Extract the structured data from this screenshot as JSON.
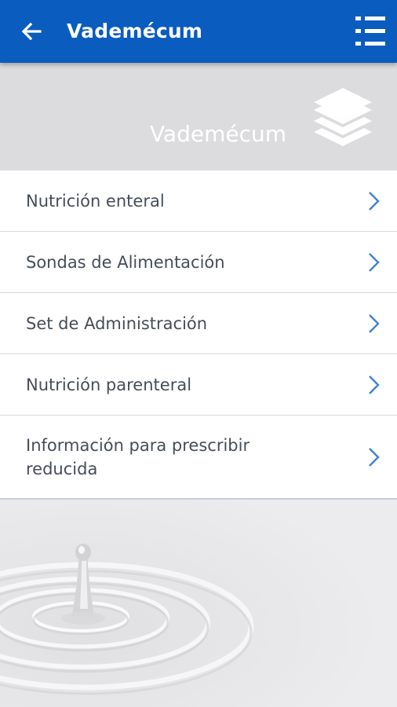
{
  "app_bar": {
    "title": "Vademécum",
    "back_icon": "arrow-left-icon",
    "menu_icon": "list-menu-icon",
    "background_color": "#0a5cbf"
  },
  "banner": {
    "title": "Vademécum",
    "icon": "layers-icon"
  },
  "menu": {
    "items": [
      {
        "label": "Nutrición enteral",
        "icon": "chevron-right-icon"
      },
      {
        "label": "Sondas de Alimentación",
        "icon": "chevron-right-icon"
      },
      {
        "label": "Set de Administración",
        "icon": "chevron-right-icon"
      },
      {
        "label": "Nutrición parenteral",
        "icon": "chevron-right-icon"
      },
      {
        "label": "Información para prescribir reducida",
        "icon": "chevron-right-icon"
      }
    ],
    "chevron_color": "#3d82cf"
  },
  "background": {
    "image": "water-drop-splash"
  }
}
